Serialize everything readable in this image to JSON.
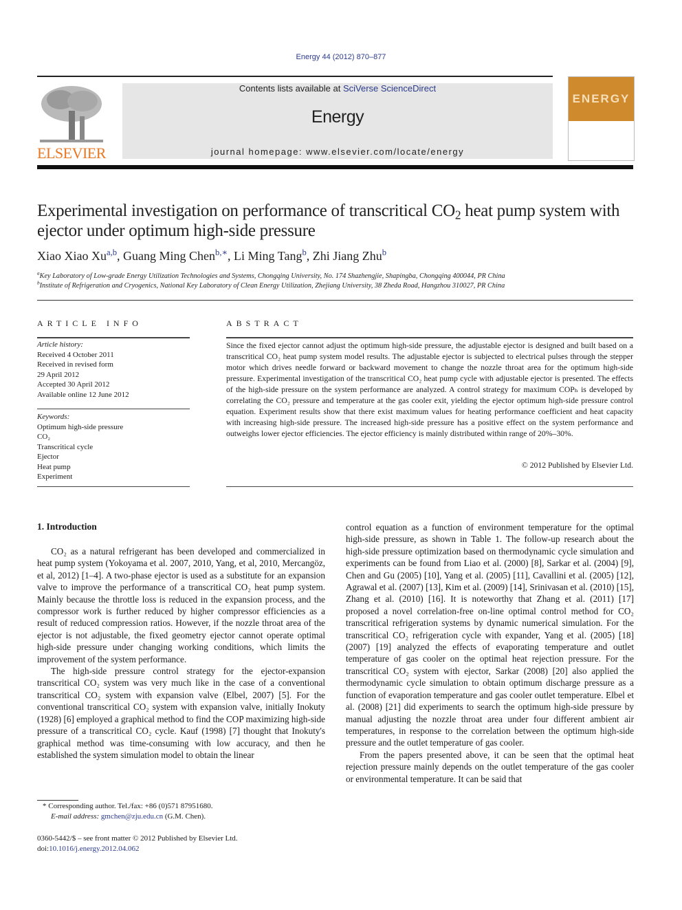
{
  "header": {
    "citation": "Energy 44 (2012) 870–877",
    "contents_prefix": "Contents lists available at ",
    "contents_link": "SciVerse ScienceDirect",
    "journal_name": "Energy",
    "homepage": "journal homepage: www.elsevier.com/locate/energy",
    "publisher_logo_text": "ELSEVIER",
    "cover_title": "ENERGY",
    "brand_orange": "#e87722",
    "cover_color": "#d08a2e",
    "link_color": "#2b3a8c"
  },
  "article": {
    "title_part1": "Experimental investigation on performance of transcritical CO",
    "title_sub": "2",
    "title_part2": " heat pump system with ejector under optimum high-side pressure",
    "authors": [
      {
        "name": "Xiao Xiao Xu",
        "aff": "a,b"
      },
      {
        "name": "Guang Ming Chen",
        "aff": "b,∗"
      },
      {
        "name": "Li Ming Tang",
        "aff": "b"
      },
      {
        "name": "Zhi Jiang Zhu",
        "aff": "b"
      }
    ],
    "affiliations": [
      {
        "mark": "a",
        "text": "Key Laboratory of Low-grade Energy Utilization Technologies and Systems, Chongqing University, No. 174 Shazhengjie, Shapingba, Chongqing 400044, PR China"
      },
      {
        "mark": "b",
        "text": "Institute of Refrigeration and Cryogenics, National Key Laboratory of Clean Energy Utilization, Zhejiang University, 38 Zheda Road, Hangzhou 310027, PR China"
      }
    ]
  },
  "article_info": {
    "heading": "ARTICLE INFO",
    "history_label": "Article history:",
    "history": [
      "Received 4 October 2011",
      "Received in revised form",
      "29 April 2012",
      "Accepted 30 April 2012",
      "Available online 12 June 2012"
    ],
    "keywords_label": "Keywords:",
    "keywords": [
      "Optimum high-side pressure",
      "CO₂",
      "Transcritical cycle",
      "Ejector",
      "Heat pump",
      "Experiment"
    ]
  },
  "abstract": {
    "heading": "ABSTRACT",
    "text": "Since the fixed ejector cannot adjust the optimum high-side pressure, the adjustable ejector is designed and built based on a transcritical CO₂ heat pump system model results. The adjustable ejector is subjected to electrical pulses through the stepper motor which drives needle forward or backward movement to change the nozzle throat area for the optimum high-side pressure. Experimental investigation of the transcritical CO₂ heat pump cycle with adjustable ejector is presented. The effects of the high-side pressure on the system performance are analyzed. A control strategy for maximum COPₕ is developed by correlating the CO₂ pressure and temperature at the gas cooler exit, yielding the ejector optimum high-side pressure control equation. Experiment results show that there exist maximum values for heating performance coefficient and heat capacity with increasing high-side pressure. The increased high-side pressure has a positive effect on the system performance and outweighs lower ejector efficiencies. The ejector efficiency is mainly distributed within range of 20%–30%.",
    "copyright": "© 2012 Published by Elsevier Ltd."
  },
  "introduction": {
    "heading": "1.  Introduction",
    "para1": "CO₂ as a natural refrigerant has been developed and commercialized in heat pump system (Yokoyama et al. 2007, 2010, Yang, et al, 2010, Mercangöz, et al, 2012) [1–4]. A two-phase ejector is used as a substitute for an expansion valve to improve the performance of a transcritical CO₂ heat pump system. Mainly because the throttle loss is reduced in the expansion process, and the compressor work is further reduced by higher compressor efficiencies as a result of reduced compression ratios. However, if the nozzle throat area of the ejector is not adjustable, the fixed geometry ejector cannot operate optimal high-side pressure under changing working conditions, which limits the improvement of the system performance.",
    "para2": "The high-side pressure control strategy for the ejector-expansion transcritical CO₂ system was very much like in the case of a conventional transcritical CO₂ system with expansion valve (Elbel, 2007) [5]. For the conventional transcritical CO₂ system with expansion valve, initially Inokuty (1928) [6] employed a graphical method to find the COP maximizing high-side pressure of a transcritical CO₂ cycle. Kauf (1998) [7] thought that Inokuty's graphical method was time-consuming with low accuracy, and then he established the system simulation model to obtain the linear",
    "para3": "control equation as a function of environment temperature for the optimal high-side pressure, as shown in Table 1. The follow-up research about the high-side pressure optimization based on thermodynamic cycle simulation and experiments can be found from Liao et al. (2000) [8], Sarkar et al. (2004) [9], Chen and Gu (2005) [10], Yang et al. (2005) [11], Cavallini et al. (2005) [12], Agrawal et al. (2007) [13], Kim et al. (2009) [14], Srinivasan et al. (2010) [15], Zhang et al. (2010) [16]. It is noteworthy that Zhang et al. (2011) [17] proposed a novel correlation-free on-line optimal control method for CO₂ transcritical refrigeration systems by dynamic numerical simulation. For the transcritical CO₂ refrigeration cycle with expander, Yang et al. (2005) [18] (2007) [19] analyzed the effects of evaporating temperature and outlet temperature of gas cooler on the optimal heat rejection pressure. For the transcritical CO₂ system with ejector, Sarkar (2008) [20] also applied the thermodynamic cycle simulation to obtain optimum discharge pressure as a function of evaporation temperature and gas cooler outlet temperature. Elbel et al. (2008) [21] did experiments to search the optimum high-side pressure by manual adjusting the nozzle throat area under four different ambient air temperatures, in response to the correlation between the optimum high-side pressure and the outlet temperature of gas cooler.",
    "para4": "From the papers presented above, it can be seen that the optimal heat rejection pressure mainly depends on the outlet temperature of the gas cooler or environmental temperature. It can be said that"
  },
  "footnote": {
    "star": "*",
    "corresponding": "Corresponding author. Tel./fax: +86 (0)571 87951680.",
    "email_label": "E-mail address:",
    "email": "gmchen@zju.edu.cn",
    "email_suffix": "(G.M. Chen)."
  },
  "front_matter": {
    "line1": "0360-5442/$ – see front matter © 2012 Published by Elsevier Ltd.",
    "doi_prefix": "doi:",
    "doi": "10.1016/j.energy.2012.04.062"
  }
}
